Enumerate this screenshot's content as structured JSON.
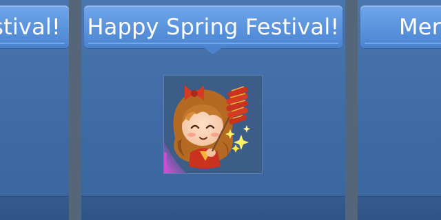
{
  "cards": [
    {
      "title": "stival!"
    },
    {
      "title": "Happy Spring Festival!"
    },
    {
      "title": "Merr"
    }
  ],
  "colors": {
    "accent": "#5a93dc",
    "card_bg": "#4374ad",
    "text": "#ffffff",
    "rarity_glow": "#d24bd8"
  },
  "icons": {
    "sticker": "girl-with-firecrackers-sticker"
  }
}
